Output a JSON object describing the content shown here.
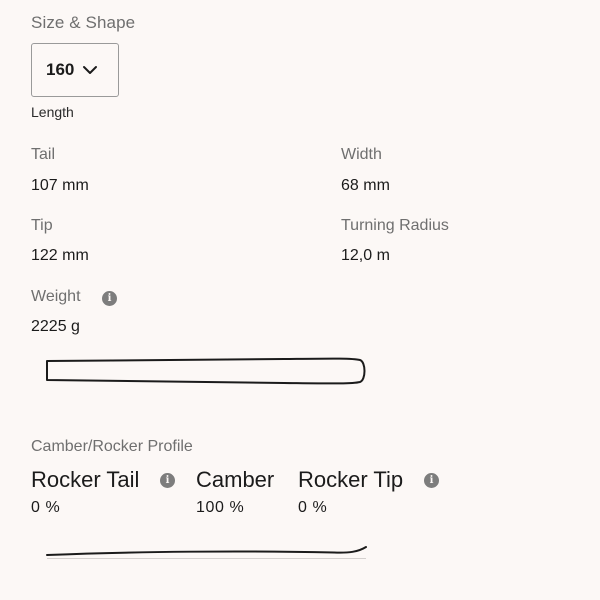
{
  "size_shape": {
    "title": "Size & Shape",
    "selected_length": "160",
    "length_label": "Length"
  },
  "specs": {
    "tail": {
      "label": "Tail",
      "value": "107 mm"
    },
    "width": {
      "label": "Width",
      "value": "68 mm"
    },
    "tip": {
      "label": "Tip",
      "value": "122 mm"
    },
    "turning_radius": {
      "label": "Turning Radius",
      "value": "12,0 m"
    },
    "weight": {
      "label": "Weight",
      "value": "2225 g"
    }
  },
  "profile": {
    "title": "Camber/Rocker Profile",
    "rocker_tail": {
      "label": "Rocker Tail",
      "value": "0 %"
    },
    "camber": {
      "label": "Camber",
      "value": "100 %"
    },
    "rocker_tip": {
      "label": "Rocker Tip",
      "value": "0 %"
    }
  },
  "icons": {
    "dropdown": "chevron-down-icon",
    "info": "info-icon"
  },
  "colors": {
    "background": "#fcf8f6",
    "label_gray": "#6f6f6f",
    "text": "#1b1b1b",
    "info_icon": "#7d7d7d"
  }
}
